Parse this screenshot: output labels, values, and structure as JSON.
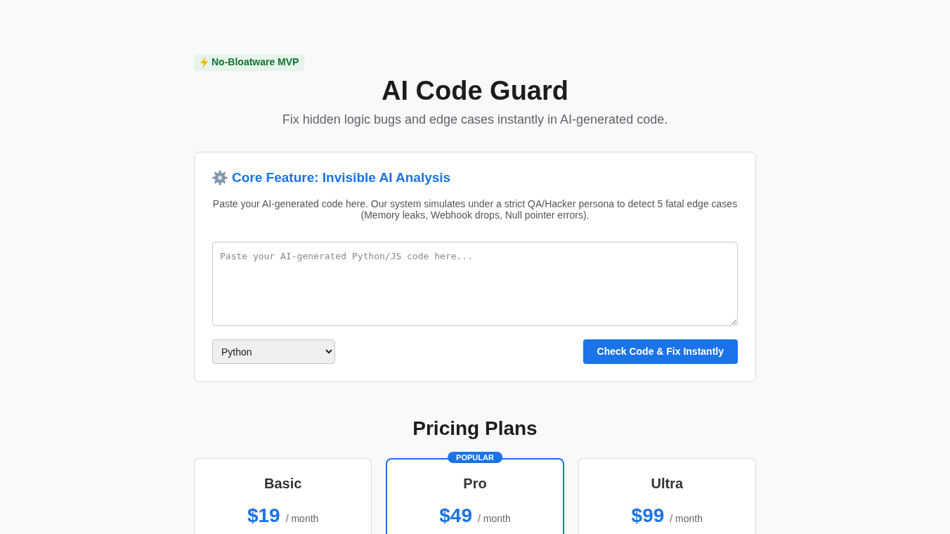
{
  "badge": {
    "text": "No-Bloatware MVP"
  },
  "title": "AI Code Guard",
  "subtitle": "Fix hidden logic bugs and edge cases instantly in AI-generated code.",
  "analyzer": {
    "heading": "Core Feature: Invisible AI Analysis",
    "description": "Paste your AI-generated code here. Our system simulates under a strict QA/Hacker persona to detect 5 fatal edge cases (Memory leaks, Webhook drops, Null pointer errors).",
    "code_input": {
      "placeholder": "Paste your AI-generated Python/JS code here..."
    },
    "language_select": {
      "value": "Python"
    },
    "submit_button": "Check Code & Fix Instantly"
  },
  "pricing": {
    "heading": "Pricing Plans",
    "plans": [
      {
        "name": "Basic",
        "price": "$19",
        "period": "/ month",
        "featured": false
      },
      {
        "name": "Pro",
        "price": "$49",
        "period": "/ month",
        "featured": true,
        "ribbon": "POPULAR"
      },
      {
        "name": "Ultra",
        "price": "$99",
        "period": "/ month",
        "featured": false
      }
    ]
  }
}
